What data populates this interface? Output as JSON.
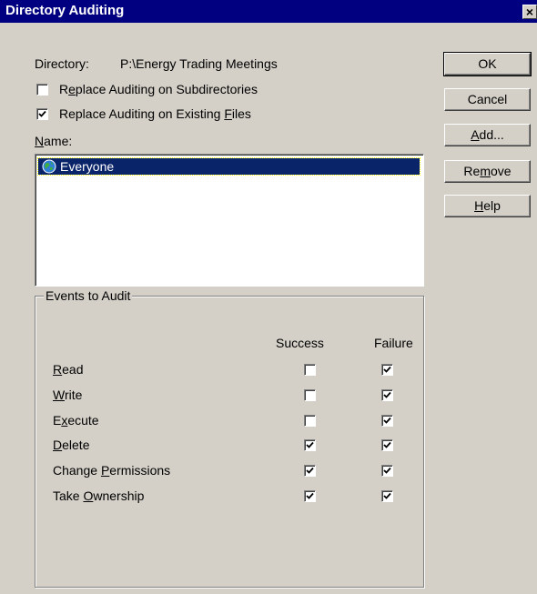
{
  "window": {
    "title": "Directory Auditing",
    "close_glyph": "×"
  },
  "directory": {
    "label": "Directory:",
    "value": "P:\\Energy Trading Meetings"
  },
  "options": {
    "replace_subdirs": {
      "label_pre": "R",
      "label_u": "e",
      "label_post": "place Auditing on Subdirectories",
      "checked": false
    },
    "replace_files": {
      "label_pre": "Replace Auditing on Existing ",
      "label_u": "F",
      "label_post": "iles",
      "checked": true
    }
  },
  "names": {
    "label_u": "N",
    "label_post": "ame:",
    "items": [
      {
        "label": "Everyone",
        "icon": "globe-icon",
        "selected": true
      }
    ]
  },
  "buttons": {
    "ok": "OK",
    "cancel": "Cancel",
    "add": {
      "u": "A",
      "rest": "dd..."
    },
    "remove": {
      "pre": "Re",
      "u": "m",
      "rest": "ove"
    },
    "help": {
      "u": "H",
      "rest": "elp"
    }
  },
  "events": {
    "title": "Events to Audit",
    "success_header": "Success",
    "failure_header": "Failure",
    "rows": [
      {
        "pre": "",
        "u": "R",
        "post": "ead",
        "success": false,
        "failure": true
      },
      {
        "pre": "",
        "u": "W",
        "post": "rite",
        "success": false,
        "failure": true
      },
      {
        "pre": "E",
        "u": "x",
        "post": "ecute",
        "success": false,
        "failure": true
      },
      {
        "pre": "",
        "u": "D",
        "post": "elete",
        "success": true,
        "failure": true
      },
      {
        "pre": "Change ",
        "u": "P",
        "post": "ermissions",
        "success": true,
        "failure": true
      },
      {
        "pre": "Take ",
        "u": "O",
        "post": "wnership",
        "success": true,
        "failure": true
      }
    ]
  },
  "colors": {
    "face": "#d4d0c8",
    "title_bar": "#000080",
    "selection": "#0a246a"
  }
}
